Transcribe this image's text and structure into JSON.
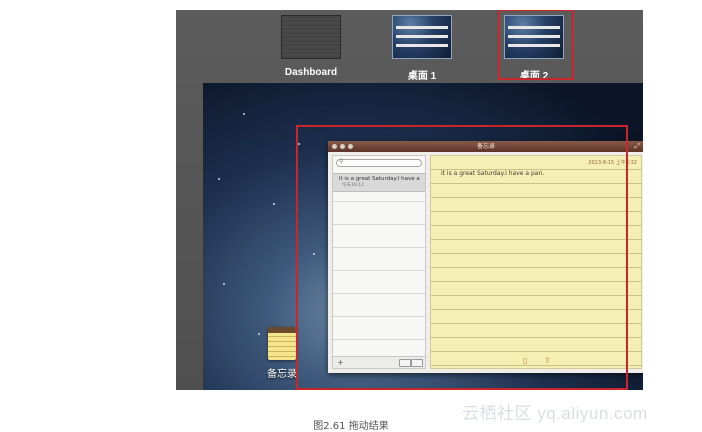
{
  "spaces": {
    "dashboard_label": "Dashboard",
    "desktop1_label": "桌面 1",
    "desktop2_label": "桌面 2"
  },
  "notes_window": {
    "title": "备忘录",
    "resize_icon": "resize-arrows-icon",
    "search": {
      "icon": "search-icon",
      "value": ""
    },
    "list": [
      {
        "title": "it is a great Saturday.I have a",
        "date": "今天16:12"
      }
    ],
    "note": {
      "date": "2013-8-15 上午8:32",
      "text": "it is a great Saturday.I have a pan."
    },
    "footer_icons": [
      "add-note-icon",
      "view-toggle-icon",
      "trash-icon",
      "share-icon"
    ]
  },
  "dock_app": {
    "label": "备忘录",
    "icon": "notes-app-icon"
  },
  "caption": "图2.61    拖动结果",
  "watermark": "云栖社区 yq.aliyun.com",
  "colors": {
    "highlight": "#c9262b",
    "titlebar": "#5d3427",
    "paper": "#f6efb5",
    "screen_bg": "#555555"
  }
}
